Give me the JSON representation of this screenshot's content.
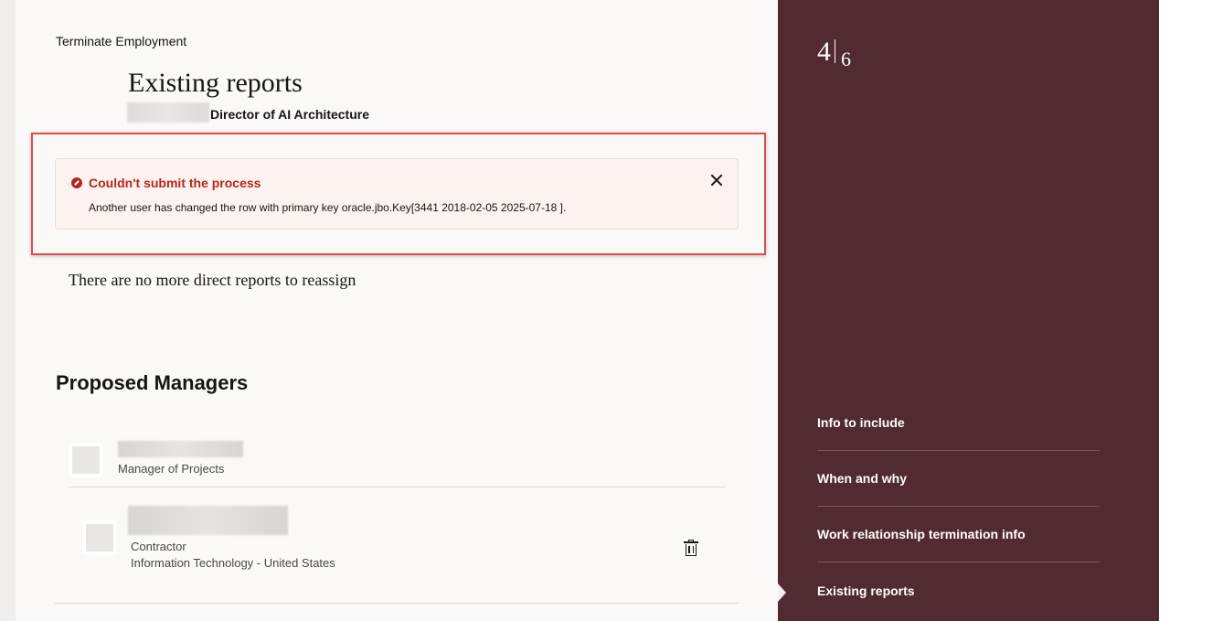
{
  "header": {
    "process_title": "Terminate Employment",
    "page_title": "Existing reports",
    "subtitle": "Director of AI Architecture"
  },
  "error": {
    "title": "Couldn't submit the process",
    "message": "Another user has changed the row with primary key oracle.jbo.Key[3441 2018-02-05 2025-07-18 ].",
    "icon": "error-circle-icon",
    "close_icon": "close-icon"
  },
  "reports": {
    "empty_message": "There are no more direct reports to reassign"
  },
  "proposed_managers": {
    "section_title": "Proposed Managers",
    "items": [
      {
        "role": "Manager of Projects"
      },
      {
        "role": "Contractor",
        "detail": "Information Technology - United States",
        "delete_icon": "trash-icon"
      }
    ]
  },
  "progress": {
    "current": "4",
    "total": "6"
  },
  "steps": [
    {
      "label": "Info to include"
    },
    {
      "label": "When and why"
    },
    {
      "label": "Work relationship termination info"
    },
    {
      "label": "Existing reports",
      "current": true
    }
  ],
  "colors": {
    "panel_background": "#512a32",
    "error_text": "#b3261e",
    "error_background": "#fcf3f1",
    "highlight_border": "#e24b4b"
  }
}
